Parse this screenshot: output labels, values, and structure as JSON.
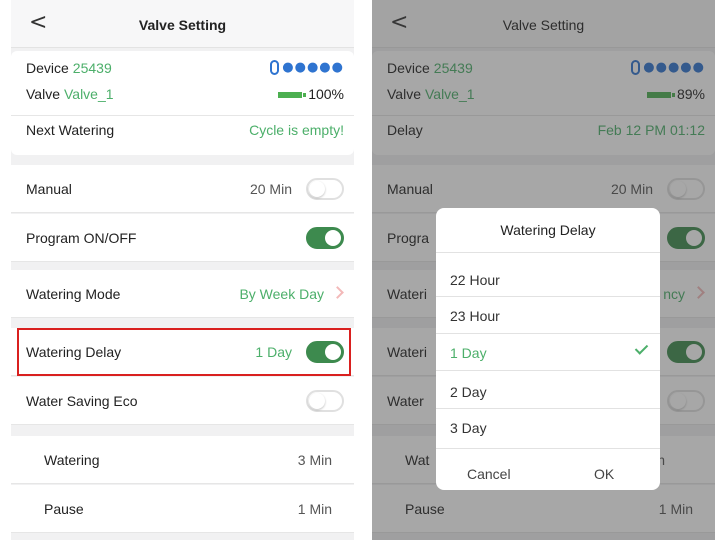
{
  "left": {
    "navbar": {
      "title": "Valve Setting",
      "back_icon": "chevron-left-icon"
    },
    "info": {
      "device_label": "Device",
      "device_value": "25439",
      "valve_label": "Valve",
      "valve_value": "Valve_1",
      "signal_icon": "bluetooth-icon",
      "signal_dots": "●●●●●",
      "battery": "100%",
      "row3_label": "Next Watering",
      "row3_value": "Cycle is empty!"
    },
    "rows": {
      "manual": {
        "label": "Manual",
        "value": "20 Min",
        "toggle": false
      },
      "program": {
        "label": "Program ON/OFF",
        "toggle": true
      },
      "mode": {
        "label": "Watering Mode",
        "value": "By Week Day"
      },
      "delay": {
        "label": "Watering Delay",
        "value": "1 Day",
        "toggle": true
      },
      "eco": {
        "label": "Water Saving Eco",
        "toggle": false
      },
      "watering": {
        "label": "Watering",
        "value": "3 Min"
      },
      "pause": {
        "label": "Pause",
        "value": "1 Min"
      }
    }
  },
  "right": {
    "navbar": {
      "title": "Valve Setting"
    },
    "info": {
      "device_label": "Device",
      "device_value": "25439",
      "valve_label": "Valve",
      "valve_value": "Valve_1",
      "signal_dots": "●●●●●",
      "battery": "89%",
      "row3_label": "Delay",
      "row3_value": "Feb 12 PM 01:12"
    },
    "rows": {
      "manual": {
        "label": "Manual",
        "value": "20 Min"
      },
      "program": {
        "label": "Progra"
      },
      "mode": {
        "label": "Wateri",
        "value": "ncy"
      },
      "delay": {
        "label": "Wateri"
      },
      "eco": {
        "label": "Water"
      },
      "watering": {
        "label": "Wat",
        "value": "n"
      },
      "pause": {
        "label": "Pause",
        "value": "1 Min"
      }
    },
    "dialog": {
      "title": "Watering Delay",
      "options": [
        "22 Hour",
        "23 Hour",
        "1 Day",
        "2 Day",
        "3 Day"
      ],
      "selected": "1 Day",
      "cancel": "Cancel",
      "ok": "OK"
    }
  },
  "colors": {
    "accent": "#4caf6a",
    "toggle_on": "#3d8a4e",
    "highlight": "#d9201f",
    "bluetooth": "#2f74d0"
  }
}
